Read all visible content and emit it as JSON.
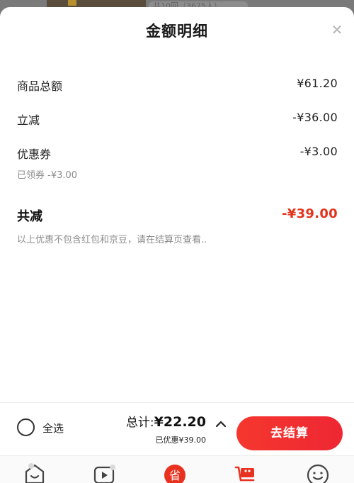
{
  "background": {
    "tag_text": "共10回（3675人）"
  },
  "sheet": {
    "title": "金额明细",
    "close_icon": "close-icon"
  },
  "breakdown": {
    "items": [
      {
        "label": "商品总额",
        "value": "¥61.20"
      },
      {
        "label": "立减",
        "value": "-¥36.00"
      },
      {
        "label": "优惠券",
        "value": "-¥3.00",
        "sub": "已领券 -¥3.00"
      }
    ],
    "total_reduction": {
      "label": "共减",
      "value": "-¥39.00"
    },
    "note": "以上优惠不包含红包和京豆，请在结算页查看.."
  },
  "checkout": {
    "select_all_label": "全选",
    "total_label": "总计:",
    "total_amount": "¥22.20",
    "discount_text": "已优惠¥39.00",
    "button_label": "去结算"
  },
  "tabbar": {
    "icons": [
      "home-icon",
      "video-icon",
      "save-money-icon",
      "cart-icon",
      "profile-icon"
    ]
  },
  "colors": {
    "accent_red": "#e2341d",
    "button_red": "#f5372e"
  }
}
